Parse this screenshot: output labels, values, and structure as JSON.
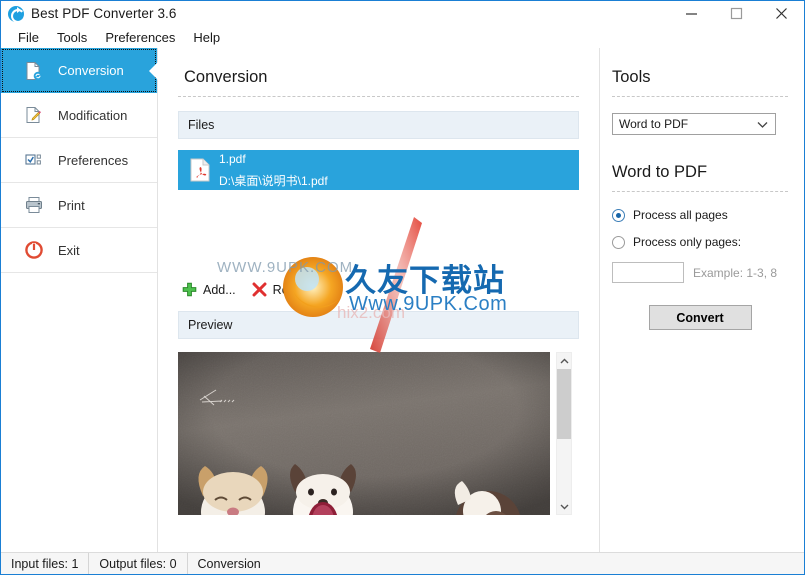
{
  "window": {
    "title": "Best PDF Converter 3.6",
    "app_icon": "refresh-circle-icon",
    "minimize": "minimize-icon",
    "maximize": "maximize-icon",
    "close": "close-icon"
  },
  "menubar": {
    "items": [
      {
        "label": "File"
      },
      {
        "label": "Tools"
      },
      {
        "label": "Preferences"
      },
      {
        "label": "Help"
      }
    ]
  },
  "sidebar": {
    "items": [
      {
        "label": "Conversion",
        "icon": "document-convert-icon",
        "active": true
      },
      {
        "label": "Modification",
        "icon": "document-edit-icon",
        "active": false
      },
      {
        "label": "Preferences",
        "icon": "checkbox-list-icon",
        "active": false
      },
      {
        "label": "Print",
        "icon": "printer-icon",
        "active": false
      },
      {
        "label": "Exit",
        "icon": "power-icon",
        "active": false
      }
    ]
  },
  "main": {
    "title": "Conversion",
    "files_section": {
      "header": "Files",
      "rows": [
        {
          "name": "1.pdf",
          "path": "D:\\桌面\\说明书\\1.pdf",
          "icon": "pdf-file-icon",
          "selected": true
        }
      ],
      "buttons": [
        {
          "label": "Add...",
          "icon": "plus-icon"
        },
        {
          "label": "Remove",
          "icon": "red-x-icon"
        }
      ]
    },
    "preview_section": {
      "header": "Preview",
      "image_alt": "three puppies on gray concrete",
      "scroll_up": "chevron-up-icon",
      "scroll_down": "chevron-down-icon"
    }
  },
  "tools": {
    "title": "Tools",
    "selected_tool": "Word to PDF",
    "dropdown_icon": "chevron-down-icon",
    "subtitle": "Word to PDF",
    "radios": [
      {
        "label": "Process all pages",
        "checked": true
      },
      {
        "label": "Process only pages:",
        "checked": false
      }
    ],
    "pages_value": "",
    "pages_placeholder": "",
    "pages_hint": "Example: 1-3, 8",
    "convert_label": "Convert"
  },
  "statusbar": {
    "input_files": "Input files: 1",
    "output_files": "Output files: 0",
    "mode": "Conversion"
  },
  "watermark": {
    "chinese": "久友下载站",
    "url": "Www.9UPK.Com",
    "ghost_left": "WWW.9UPK.COM",
    "ghost_bottom": "hix2.com"
  },
  "colors": {
    "accent": "#29a3dc",
    "section_header_bg": "#eaf1f7",
    "titlebar_border": "#1a7fd4"
  }
}
